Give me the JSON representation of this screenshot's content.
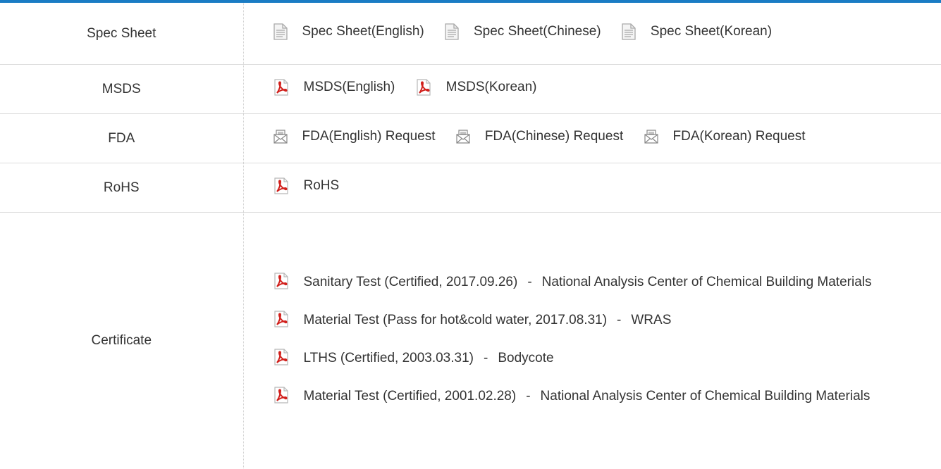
{
  "colors": {
    "accent": "#1a7cc4",
    "pdf_red": "#d1201c",
    "doc_gray": "#a9a9a9"
  },
  "rows": {
    "spec": {
      "label": "Spec Sheet",
      "items": [
        {
          "icon": "document-icon",
          "text": "Spec Sheet(English)"
        },
        {
          "icon": "document-icon",
          "text": "Spec Sheet(Chinese)"
        },
        {
          "icon": "document-icon",
          "text": "Spec Sheet(Korean)"
        }
      ]
    },
    "msds": {
      "label": "MSDS",
      "items": [
        {
          "icon": "pdf-icon",
          "text": "MSDS(English)"
        },
        {
          "icon": "pdf-icon",
          "text": "MSDS(Korean)"
        }
      ]
    },
    "fda": {
      "label": "FDA",
      "items": [
        {
          "icon": "mail-icon",
          "text": "FDA(English) Request"
        },
        {
          "icon": "mail-icon",
          "text": "FDA(Chinese) Request"
        },
        {
          "icon": "mail-icon",
          "text": "FDA(Korean) Request"
        }
      ]
    },
    "rohs": {
      "label": "RoHS",
      "items": [
        {
          "icon": "pdf-icon",
          "text": "RoHS"
        }
      ]
    },
    "certificate": {
      "label": "Certificate",
      "items": [
        {
          "icon": "pdf-icon",
          "title": "Sanitary Test (Certified, 2017.09.26)",
          "separator": "-",
          "org": "National Analysis Center of Chemical Building Materials"
        },
        {
          "icon": "pdf-icon",
          "title": "Material Test (Pass for hot&cold water, 2017.08.31)",
          "separator": "-",
          "org": "WRAS"
        },
        {
          "icon": "pdf-icon",
          "title": "LTHS (Certified, 2003.03.31)",
          "separator": "-",
          "org": "Bodycote"
        },
        {
          "icon": "pdf-icon",
          "title": "Material Test (Certified, 2001.02.28)",
          "separator": "-",
          "org": "National Analysis Center of Chemical Building Materials"
        }
      ]
    }
  }
}
